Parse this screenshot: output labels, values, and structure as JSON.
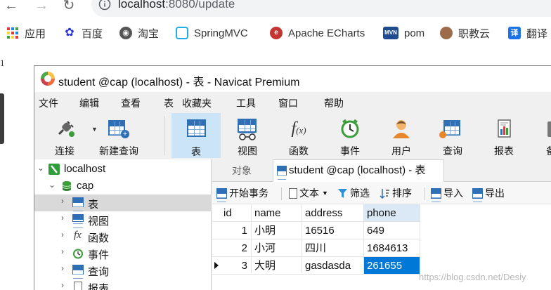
{
  "browser": {
    "url_host": "localhost",
    "url_rest": ":8080/update",
    "bookmarks": [
      {
        "label": "应用",
        "icon": "apps-grid-icon"
      },
      {
        "label": "百度",
        "icon": "baidu-paw-icon"
      },
      {
        "label": "淘宝",
        "icon": "globe-icon"
      },
      {
        "label": "SpringMVC",
        "icon": "bilibili-tv-icon"
      },
      {
        "label": "Apache ECharts",
        "icon": "echarts-icon"
      },
      {
        "label": "pom",
        "icon": "maven-icon"
      },
      {
        "label": "职教云",
        "icon": "zhijiaoyun-icon"
      },
      {
        "label": "翻译",
        "icon": "translate-icon"
      }
    ]
  },
  "page": {
    "line_number": "1"
  },
  "navicat": {
    "title": "student @cap (localhost) - 表 - Navicat Premium",
    "menu": [
      "文件",
      "编辑",
      "查看",
      "表",
      "收藏夹",
      "工具",
      "窗口",
      "帮助"
    ],
    "toolbar": [
      {
        "label": "连接",
        "icon": "plug-icon"
      },
      {
        "label": "新建查询",
        "icon": "new-query-icon"
      },
      {
        "label": "表",
        "icon": "table-icon"
      },
      {
        "label": "视图",
        "icon": "view-glasses-icon"
      },
      {
        "label": "函数",
        "icon": "function-icon"
      },
      {
        "label": "事件",
        "icon": "clock-icon"
      },
      {
        "label": "用户",
        "icon": "user-icon"
      },
      {
        "label": "查询",
        "icon": "query-icon"
      },
      {
        "label": "报表",
        "icon": "report-icon"
      },
      {
        "label": "备",
        "icon": "backup-icon"
      }
    ],
    "tree": [
      {
        "label": "localhost",
        "icon": "connection-icon"
      },
      {
        "label": "cap",
        "icon": "database-icon"
      },
      {
        "label": "表",
        "icon": "table-icon"
      },
      {
        "label": "视图",
        "icon": "view-glasses-icon"
      },
      {
        "label": "函数",
        "icon": "function-icon"
      },
      {
        "label": "事件",
        "icon": "clock-icon"
      },
      {
        "label": "查询",
        "icon": "query-icon"
      },
      {
        "label": "报表",
        "icon": "report-icon"
      }
    ],
    "tabs": {
      "objects": "对象",
      "active": "student @cap (localhost) - 表"
    },
    "subtoolbar": {
      "begin_tx": "开始事务",
      "text": "文本",
      "filter": "筛选",
      "sort": "排序",
      "import": "导入",
      "export": "导出"
    },
    "table": {
      "columns": [
        "id",
        "name",
        "address",
        "phone"
      ],
      "rows": [
        [
          "1",
          "小明",
          "16516",
          "649"
        ],
        [
          "2",
          "小河",
          "四川",
          "1684613"
        ],
        [
          "3",
          "大明",
          "gasdasda",
          "261655"
        ]
      ]
    }
  },
  "watermark": "https://blog.csdn.net/Desiy",
  "colors": {
    "selection": "#0078d7",
    "toolbar_active": "#cce4f7",
    "tree_selected": "#d9d9d9"
  }
}
